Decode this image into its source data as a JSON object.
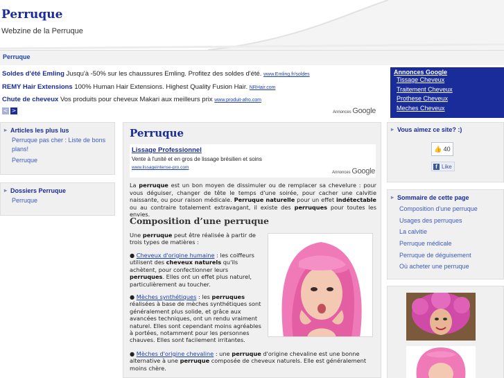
{
  "site": {
    "title": "Perruque",
    "tagline": "Webzine de la Perruque"
  },
  "breadcrumb": "Perruque",
  "top_ads": {
    "items": [
      {
        "title": "Soldes d'été Emling",
        "text": " Jusqu'à -50% sur les chaussures Emling. Profitez des soldes d'été. ",
        "url": "www.Emling.fr/soldes"
      },
      {
        "title": "REMY Hair Extensions",
        "text": " 100% Human Hair Extensions. Highest Quality Fusion Hair. ",
        "url": "NRHair.com"
      },
      {
        "title": "Chute de cheveux",
        "text": " Vos produits pour cheveux Makari aux meilleurs prix ",
        "url": "www.produit-afro.com"
      }
    ],
    "prev": "<",
    "next": ">",
    "ads_by": "Annonces",
    "google": "Google"
  },
  "right_ads": {
    "title": "Annonces Google",
    "links": [
      "Tissage Cheveux",
      "Traitement Cheveux",
      "Prothese Cheveux",
      "Meches Cheveux"
    ]
  },
  "left_sidebar": {
    "popular": {
      "title": "Articles les plus lus",
      "links": [
        "Perruque pas cher : Liste de bons plans!",
        "Perruque"
      ]
    },
    "dossiers": {
      "title": "Dossiers Perruque",
      "links": [
        "Perruque"
      ]
    }
  },
  "main": {
    "title": "Perruque",
    "inner_ad": {
      "title": "Lissage Professionnel",
      "text": "Vente à l'unité et en gros de lissage brésilien et soins",
      "url": "www.lissageintense-pro.com",
      "ads_by": "Annonces",
      "google": "Google"
    },
    "intro": {
      "t1": "La ",
      "b1": "perruque",
      "t2": " est un bon moyen de dissimuler ou de remplacer sa chevelure : pour vous déguiser, changer de tête le temps d'une soirée, pour cacher une calvitie naissante, ou pour raison médicale. ",
      "b2": "Perruque naturelle",
      "t3": " pour un effet ",
      "b3": "indétectable",
      "t4": " ou au contraire totalement extravagant, il existe des ",
      "b4": "perruques",
      "t5": " pour toutes les envies."
    },
    "section_title": "Composition d’une perruque",
    "para": {
      "t1": "Une ",
      "b1": "perruque",
      "t2": " peut être réalisée à partir de trois types de matières :"
    },
    "bullets": [
      {
        "link": "Cheveux d'origine humaine",
        "t1": " : les coiffeurs utilisent des ",
        "b1": "cheveux naturels",
        "t2": " qu'ils achètent, pour confectionner leurs ",
        "b2": "perruques",
        "t3": ". Elles ont un effet plus naturel, particulièrement au toucher."
      },
      {
        "link": "Mèches synthétiques",
        "t1": " : les ",
        "b1": "perruques",
        "t2": " réalisées à base de mèches synthétiques sont généralement plus solide, et grâce aux avancées techniques, ont un rendu vraiment naturel. Elles sont cependant moins agréables à portées, notamment pour les personnes chauves. Elles sont facilement irritantes.",
        "b2": "",
        "t3": ""
      },
      {
        "link": "Mèches d'origine chevaline",
        "t1": " : une ",
        "b1": "perruque",
        "t2": " d'origine chevaline est une bonne alternative à une ",
        "b2": "perruque",
        "t3": " composée de cheveux naturels. Elle est généralement moins chère."
      }
    ]
  },
  "right_sidebar": {
    "like_title": "Vous aimez ce site? :)",
    "like_count": "40",
    "like_label": "Like",
    "fb_letter": "f",
    "toc_title": "Sommaire de cette page",
    "toc_links": [
      "Composition d'une perruque",
      "Usages des perruques",
      "La calvitie",
      "Perruque médicale",
      "Perruque de déguisement",
      "Où acheter une perruque"
    ]
  },
  "colors": {
    "brand": "#1a2c9a",
    "link": "#3b5bbf",
    "panel": "#f0f0f0",
    "wig_pink": "#f07ab8"
  }
}
